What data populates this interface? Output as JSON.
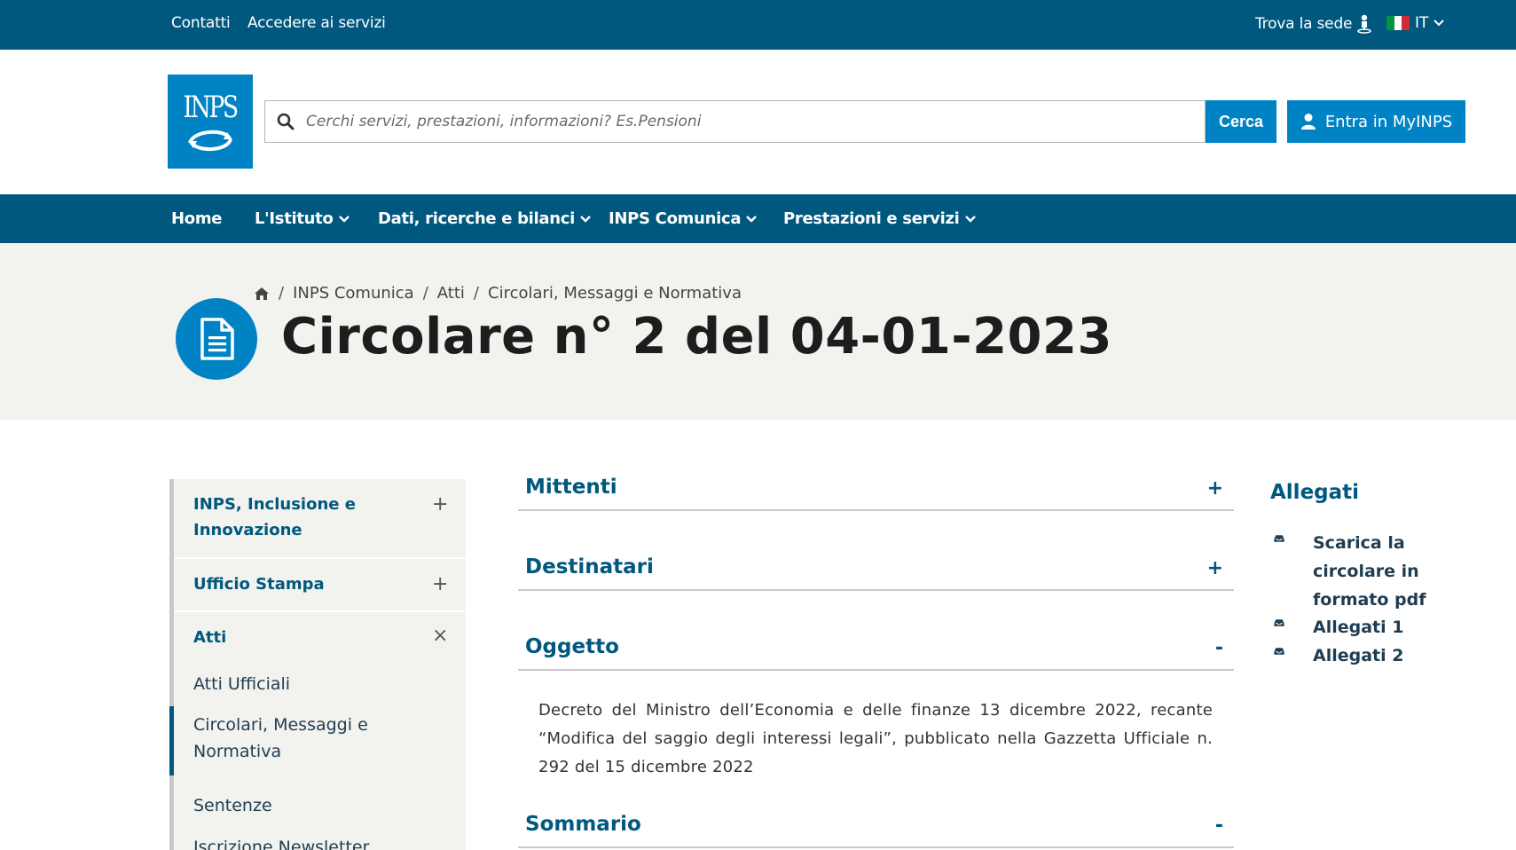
{
  "topbar": {
    "contacts": "Contatti",
    "services_access": "Accedere ai servizi",
    "find_office": "Trova la sede",
    "language": "IT"
  },
  "header": {
    "logo_text": "INPS",
    "search_placeholder": "Cerchi servizi, prestazioni, informazioni? Es.Pensioni",
    "search_button": "Cerca",
    "login_button": "Entra in MyINPS"
  },
  "nav": {
    "items": [
      {
        "label": "Home"
      },
      {
        "label": "L'Istituto"
      },
      {
        "label": "Dati, ricerche e bilanci"
      },
      {
        "label": "INPS Comunica"
      },
      {
        "label": "Prestazioni e servizi"
      }
    ]
  },
  "breadcrumb": {
    "items": [
      "INPS Comunica",
      "Atti",
      "Circolari, Messaggi e Normativa"
    ]
  },
  "page": {
    "title": "Circolare n° 2 del 04-01-2023"
  },
  "sidebar": {
    "sections": [
      {
        "label": "INPS, Inclusione e Innovazione",
        "toggle": "+"
      },
      {
        "label": "Ufficio Stampa",
        "toggle": "+"
      },
      {
        "label": "Atti",
        "toggle": "×"
      }
    ],
    "subitems": [
      {
        "label": "Atti Ufficiali"
      },
      {
        "label": "Circolari, Messaggi e Normativa"
      },
      {
        "label": "Sentenze"
      },
      {
        "label": "Iscrizione Newsletter"
      }
    ]
  },
  "accordion": [
    {
      "title": "Mittenti",
      "sign": "+"
    },
    {
      "title": "Destinatari",
      "sign": "+"
    },
    {
      "title": "Oggetto",
      "sign": "-"
    },
    {
      "title": "Sommario",
      "sign": "-"
    }
  ],
  "oggetto_text": "Decreto del Ministro dell’Economia e delle finanze 13 dicembre 2022, recante “Modifica del saggio degli interessi legali”, pubblicato nella Gazzetta Ufficiale n. 292 del 15 dicembre 2022",
  "attachments": {
    "title": "Allegati",
    "items": [
      {
        "label": "Scarica la circolare in formato pdf"
      },
      {
        "label": "Allegati 1"
      },
      {
        "label": "Allegati 2"
      }
    ]
  },
  "colors": {
    "nav_blue": "#00587f",
    "brand_blue": "#0083c5",
    "band_gray": "#f2f2ee"
  }
}
